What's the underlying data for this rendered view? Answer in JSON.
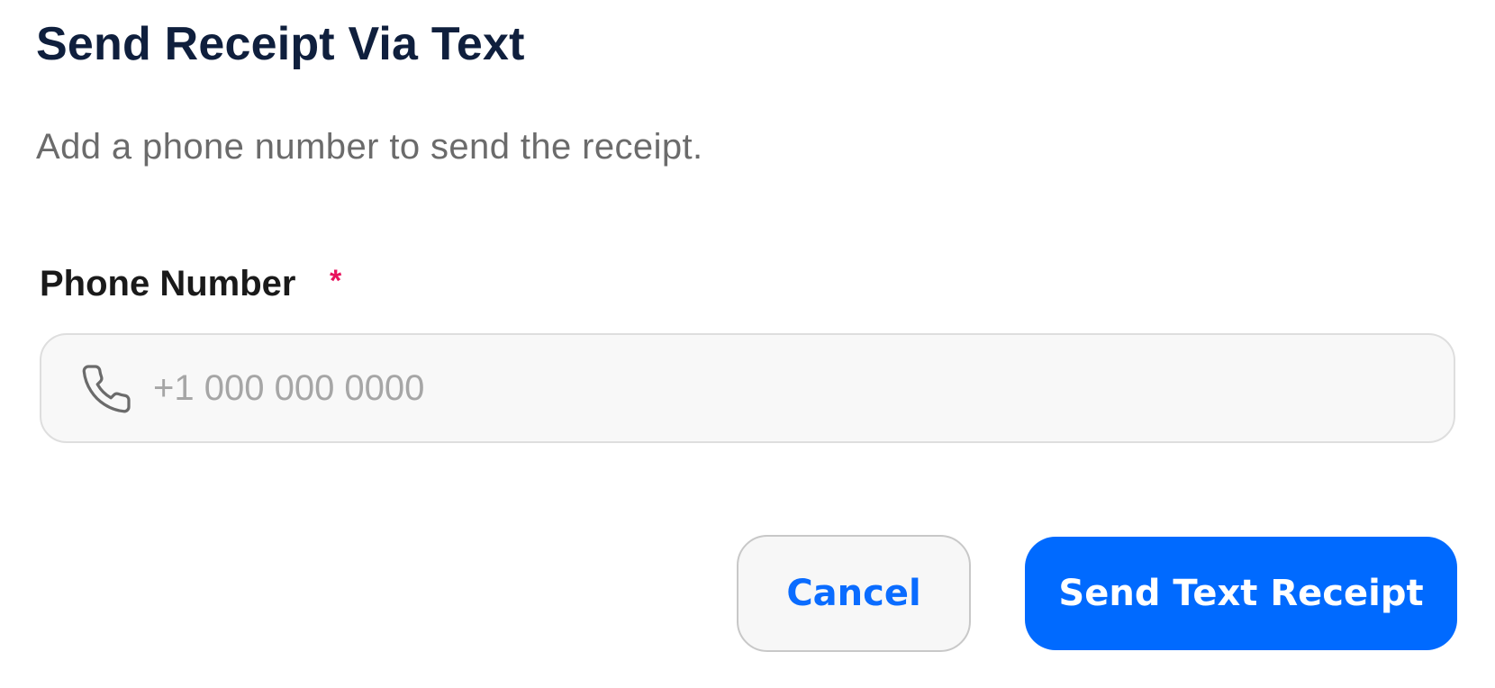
{
  "dialog": {
    "title": "Send Receipt Via Text",
    "subtitle": "Add a phone number to send the receipt."
  },
  "phone_field": {
    "label": "Phone Number",
    "required_marker": "*",
    "placeholder": "+1 000 000 0000",
    "value": "",
    "icon": "phone-icon"
  },
  "actions": {
    "cancel_label": "Cancel",
    "submit_label": "Send Text Receipt"
  },
  "colors": {
    "title": "#0f1f3d",
    "required": "#e8125c",
    "primary": "#006aff"
  }
}
